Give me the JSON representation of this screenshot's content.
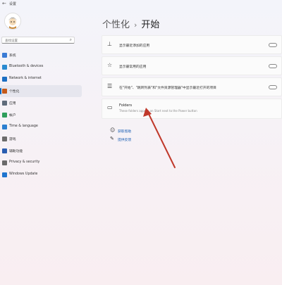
{
  "window": {
    "title": "设置",
    "back_glyph": "←"
  },
  "sidebar": {
    "search_placeholder": "查找设置",
    "items": [
      {
        "label": "系统",
        "color": "#3a7bd5"
      },
      {
        "label": "Bluetooth & devices",
        "color": "#2a8ad0"
      },
      {
        "label": "Network & internet",
        "color": "#1b6ec2"
      },
      {
        "label": "个性化",
        "color": "#c55a1a",
        "active": true
      },
      {
        "label": "应用",
        "color": "#5f6b7a"
      },
      {
        "label": "帐户",
        "color": "#2f9e5b"
      },
      {
        "label": "Time & language",
        "color": "#2b7fd0"
      },
      {
        "label": "游戏",
        "color": "#6b6b6b"
      },
      {
        "label": "辅助功能",
        "color": "#2a5db0"
      },
      {
        "label": "Privacy & security",
        "color": "#6a6a6a"
      },
      {
        "label": "Windows Update",
        "color": "#1f75cf"
      }
    ]
  },
  "breadcrumb": {
    "parent": "个性化",
    "separator": "›",
    "current": "开始"
  },
  "cards": [
    {
      "icon": "⊥",
      "text": "显示最近添加的应用"
    },
    {
      "icon": "☆",
      "text": "显示最常用的应用"
    },
    {
      "icon": "☰",
      "text": "在\"开始\"、\"跳转列表\"和\"文件资源管理器\"中显示最近打开的项目"
    },
    {
      "icon": "▭",
      "title": "Folders",
      "subtitle": "These folders appear on Start next to the Power button"
    }
  ],
  "links": [
    {
      "icon": "☺",
      "text": "获取帮助"
    },
    {
      "icon": "✎",
      "text": "提供反馈"
    }
  ],
  "annotation": {
    "color": "#c0392b"
  }
}
